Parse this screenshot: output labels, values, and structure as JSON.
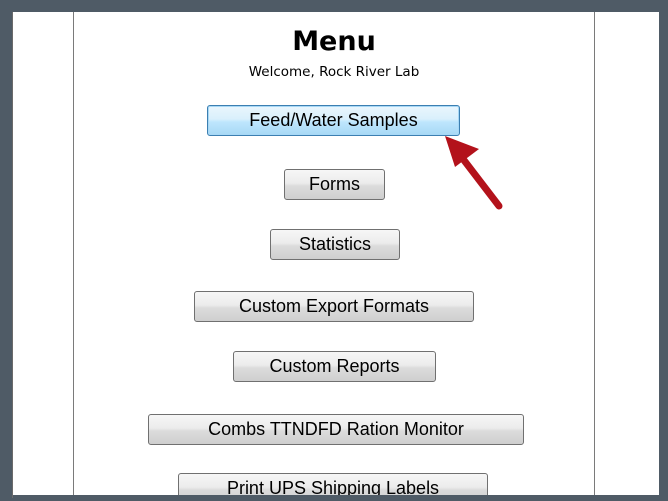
{
  "menu": {
    "title": "Menu",
    "welcome": "Welcome, Rock River Lab"
  },
  "buttons": {
    "feed_water_samples": "Feed/Water Samples",
    "forms": "Forms",
    "statistics": "Statistics",
    "custom_export_formats": "Custom Export Formats",
    "custom_reports": "Custom Reports",
    "combs_ttndfd_ration_monitor": "Combs TTNDFD Ration Monitor",
    "print_ups_shipping_labels": "Print UPS Shipping Labels"
  },
  "annotation": {
    "arrow_color": "#b3121b",
    "icon": "pointer-arrow-icon"
  }
}
